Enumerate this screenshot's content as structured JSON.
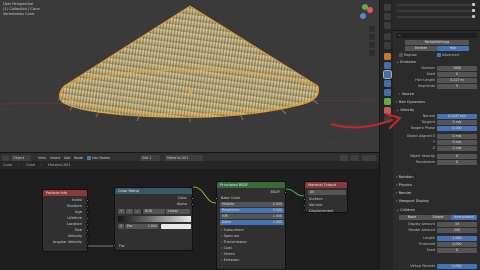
{
  "viewport": {
    "info_line1": "User Perspective",
    "info_line2": "(1) Collection | Cone",
    "info_line3": "Vertebrates Cone"
  },
  "node_editor": {
    "header": {
      "editor_type": "Object",
      "menus": [
        "View",
        "Select",
        "Add",
        "Node"
      ],
      "use_nodes_label": "Use Nodes",
      "slot": "Slot 1",
      "material": "Material.001"
    },
    "breadcrumb": [
      "Cone",
      "Cone",
      "Material.001"
    ],
    "nodes": {
      "particle_info": {
        "title": "Particle Info",
        "outputs": [
          "Index",
          "Random",
          "Age",
          "Lifetime",
          "Location",
          "Size",
          "Velocity",
          "Angular Velocity"
        ]
      },
      "color_ramp": {
        "title": "Color Ramp",
        "outputs": [
          "Color",
          "Alpha"
        ],
        "mode": "RGB",
        "interp": "Linear",
        "pos_label": "Pos",
        "pos_value": "1.000",
        "input": "Fac"
      },
      "principled": {
        "title": "Principled BSDF",
        "output": "BSDF",
        "rows": [
          {
            "label": "Base Color",
            "value": ""
          },
          {
            "label": "Metallic",
            "value": "0.000"
          },
          {
            "label": "Roughness",
            "value": "0.500"
          },
          {
            "label": "IOR",
            "value": "1.500"
          },
          {
            "label": "Alpha",
            "value": "1.000"
          }
        ],
        "subpanels": [
          "Subsurface",
          "Specular",
          "Transmission",
          "Coat",
          "Sheen",
          "Emission"
        ]
      },
      "material_output": {
        "title": "Material Output",
        "target": "All",
        "inputs": [
          "Surface",
          "Volume",
          "Displacement"
        ]
      }
    }
  },
  "properties": {
    "search_placeholder": "",
    "name": "ParticleSettings",
    "tabs": [
      "Emitter",
      "Hair"
    ],
    "regrow_label": "Regrow",
    "advanced_label": "Advanced",
    "emission": {
      "title": "Emission",
      "rows": [
        {
          "label": "Number",
          "value": "1000"
        },
        {
          "label": "Seed",
          "value": "0"
        },
        {
          "label": "Hair Length",
          "value": "0.127 m"
        },
        {
          "label": "Segments",
          "value": "5"
        }
      ]
    },
    "sections_top": [
      "Source",
      "Hair Dynamics"
    ],
    "velocity": {
      "title": "Velocity",
      "rows": [
        {
          "label": "Normal",
          "value": "0.1347 m/s"
        },
        {
          "label": "Tangent",
          "value": "0 m/s"
        },
        {
          "label": "Tangent Phase",
          "value": "0.000"
        },
        {
          "label": "Object Aligned X",
          "value": "0 m/s"
        },
        {
          "label": "Y",
          "value": "0 m/s"
        },
        {
          "label": "Z",
          "value": "0 m/s"
        },
        {
          "label": "Object Velocity",
          "value": "0"
        },
        {
          "label": "Randomize",
          "value": "0"
        }
      ]
    },
    "sections_mid": [
      "Rotation",
      "Physics",
      "Render",
      "Viewport Display"
    ],
    "children": {
      "title": "Children",
      "modes": [
        "None",
        "Simple",
        "Interpolated"
      ],
      "rows": [
        {
          "label": "Display Amount",
          "value": "10"
        },
        {
          "label": "Render Amount",
          "value": "100"
        },
        {
          "label": "Length",
          "value": "1.000"
        },
        {
          "label": "Threshold",
          "value": "0.000"
        },
        {
          "label": "Seed",
          "value": "0"
        },
        {
          "label": "Virtual Parents",
          "value": "0.000"
        }
      ]
    }
  }
}
